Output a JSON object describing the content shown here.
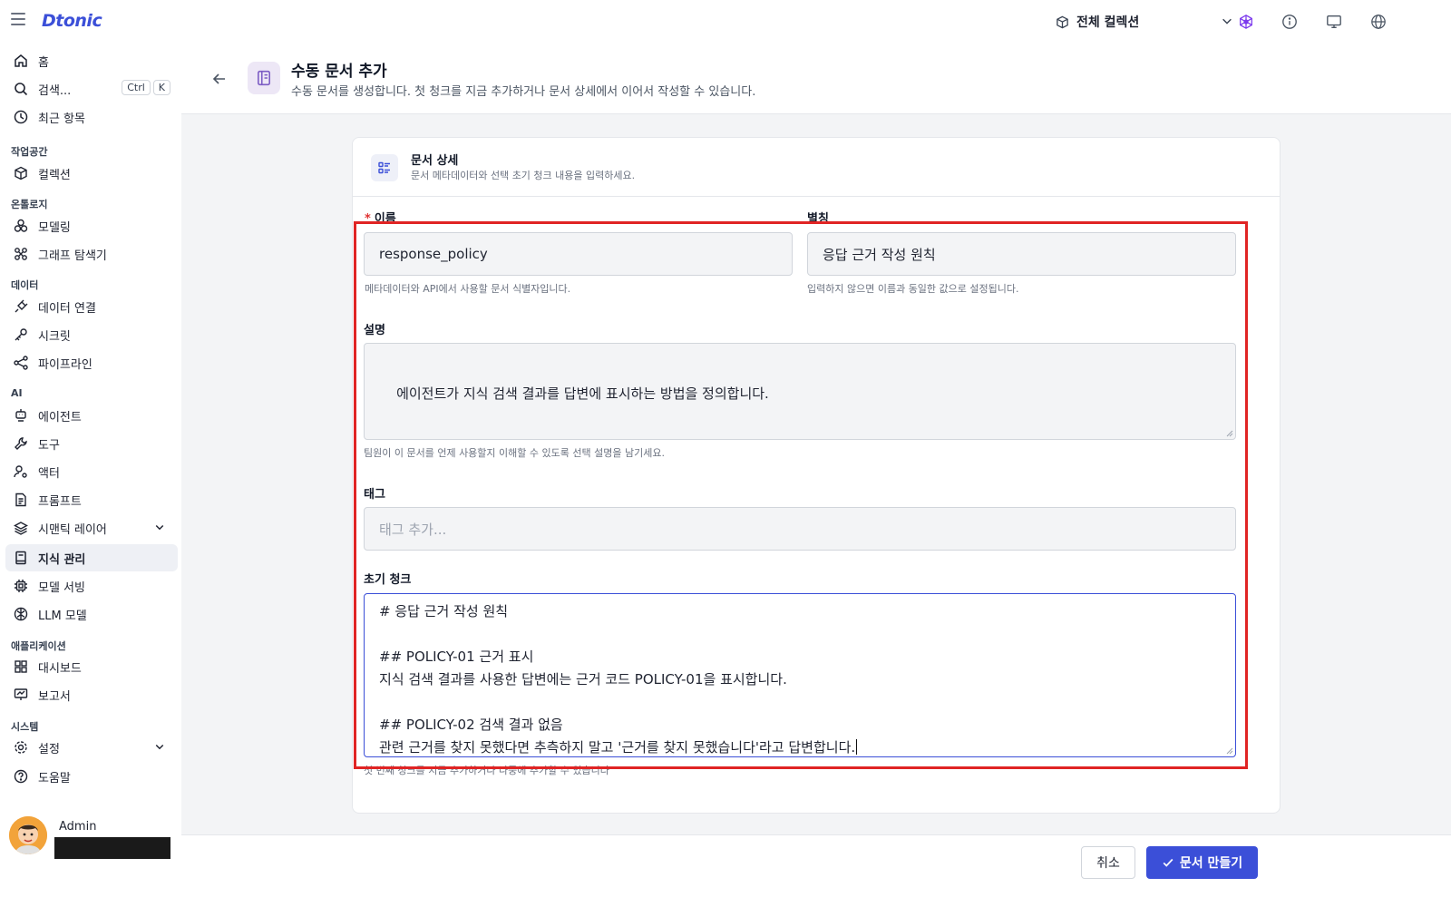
{
  "app": {
    "logo": "Dtonic"
  },
  "topbar": {
    "collection_select": "전체 컬렉션",
    "icons": [
      "graph-icon",
      "info-icon",
      "monitor-icon",
      "globe-icon"
    ]
  },
  "sidebar": {
    "home": "홈",
    "search": "검색...",
    "search_kbd": [
      "Ctrl",
      "K"
    ],
    "recent": "최근 항목",
    "sections": {
      "workspace": "작업공간",
      "ontology": "온톨로지",
      "data": "데이터",
      "ai": "AI",
      "applications": "애플리케이션",
      "system": "시스템"
    },
    "items": {
      "collections": "컬렉션",
      "modeling": "모델링",
      "graph_explorer": "그래프 탐색기",
      "data_connections": "데이터 연결",
      "secrets": "시크릿",
      "pipelines": "파이프라인",
      "agents": "에이전트",
      "tools": "도구",
      "actors": "액터",
      "prompts": "프롬프트",
      "semantic_layer": "시맨틱 레이어",
      "knowledge": "지식 관리",
      "model_serving": "모델 서빙",
      "llm_models": "LLM 모델",
      "dashboards": "대시보드",
      "reports": "보고서",
      "settings": "설정",
      "help": "도움말"
    },
    "user": {
      "name": "Admin"
    }
  },
  "header": {
    "title": "수동 문서 추가",
    "subtitle": "수동 문서를 생성합니다. 첫 청크를 지금 추가하거나 문서 상세에서 이어서 작성할 수 있습니다."
  },
  "card": {
    "title": "문서 상세",
    "subtitle": "문서 메타데이터와 선택 초기 청크 내용을 입력하세요."
  },
  "form": {
    "name": {
      "required_mark": "*",
      "label": "이름",
      "value": "response_policy",
      "hint": "메타데이터와 API에서 사용할 문서 식별자입니다."
    },
    "alias": {
      "label": "별칭",
      "value": "응답 근거 작성 원칙",
      "hint": "입력하지 않으면 이름과 동일한 값으로 설정됩니다."
    },
    "description": {
      "label": "설명",
      "value": "에이전트가 지식 검색 결과를 답변에 표시하는 방법을 정의합니다.",
      "hint": "팀원이 이 문서를 언제 사용할지 이해할 수 있도록 선택 설명을 남기세요."
    },
    "tags": {
      "label": "태그",
      "placeholder": "태그 추가..."
    },
    "initial_chunk": {
      "label": "초기 청크",
      "lines": [
        "# 응답 근거 작성 원칙",
        "",
        "## POLICY-01 근거 표시",
        "지식 검색 결과를 사용한 답변에는 근거 코드 POLICY-01을 표시합니다.",
        "",
        "## POLICY-02 검색 결과 없음",
        "관련 근거를 찾지 못했다면 추측하지 말고 '근거를 찾지 못했습니다'라고 답변합니다."
      ],
      "hint": "첫 번째 청크를 지금 추가하거나 나중에 추가할 수 있습니다"
    }
  },
  "footer": {
    "cancel": "취소",
    "create": "문서 만들기"
  },
  "colors": {
    "accent": "#3b4fd8",
    "highlight": "#e02424"
  }
}
